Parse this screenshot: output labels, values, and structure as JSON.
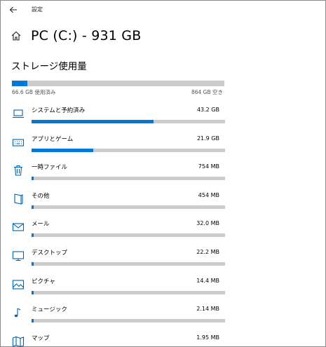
{
  "window": {
    "title": "設定"
  },
  "header": {
    "title": "PC (C:) - 931 GB"
  },
  "section": {
    "title": "ストレージ使用量"
  },
  "overall": {
    "used_label": "66.6 GB 使用済み",
    "free_label": "864 GB 空き",
    "used_fraction": 0.072
  },
  "colors": {
    "accent": "#0078d7",
    "track": "#cccccc"
  },
  "categories": [
    {
      "name": "システムと予約済み",
      "size": "43.2 GB",
      "fraction": 0.63,
      "icon": "laptop-icon"
    },
    {
      "name": "アプリとゲーム",
      "size": "21.9 GB",
      "fraction": 0.32,
      "icon": "keyboard-icon"
    },
    {
      "name": "一時ファイル",
      "size": "754 MB",
      "fraction": 0.011,
      "icon": "trash-icon"
    },
    {
      "name": "その他",
      "size": "454 MB",
      "fraction": 0.007,
      "icon": "folder-other-icon"
    },
    {
      "name": "メール",
      "size": "32.0 MB",
      "fraction": 0.003,
      "icon": "mail-icon"
    },
    {
      "name": "デスクトップ",
      "size": "22.2 MB",
      "fraction": 0.003,
      "icon": "desktop-icon"
    },
    {
      "name": "ピクチャ",
      "size": "14.4 MB",
      "fraction": 0.003,
      "icon": "picture-icon"
    },
    {
      "name": "ミュージック",
      "size": "2.14 MB",
      "fraction": 0.003,
      "icon": "music-icon"
    },
    {
      "name": "マップ",
      "size": "1.95 MB",
      "fraction": 0.003,
      "icon": "map-icon"
    }
  ]
}
